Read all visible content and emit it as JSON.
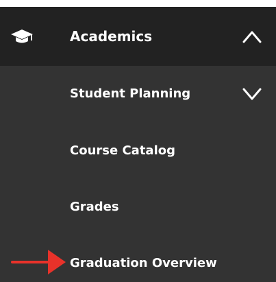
{
  "nav": {
    "header": {
      "icon": "graduation-cap-icon",
      "label": "Academics",
      "chevron": "chevron-up-icon"
    },
    "items": [
      {
        "label": "Student Planning",
        "chevron": "chevron-down-icon"
      },
      {
        "label": "Course Catalog"
      },
      {
        "label": "Grades"
      },
      {
        "label": "Graduation Overview"
      }
    ]
  },
  "annotation": {
    "icon": "red-arrow-icon",
    "color": "#e8322a",
    "points_to": "Graduation Overview"
  },
  "colors": {
    "header_bg": "#222222",
    "menu_bg": "#333333",
    "text": "#ffffff"
  }
}
